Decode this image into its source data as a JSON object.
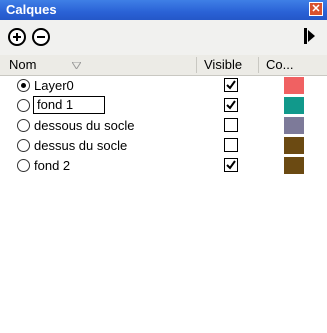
{
  "window": {
    "title": "Calques"
  },
  "toolbar": {
    "add_icon": "plus-circle-icon",
    "remove_icon": "minus-circle-icon",
    "details_icon": "arrow-right-icon"
  },
  "columns": {
    "name": "Nom",
    "visible": "Visible",
    "color": "Co..."
  },
  "layers": [
    {
      "name": "Layer0",
      "active": true,
      "visible": true,
      "color": "#f06162"
    },
    {
      "name": "fond 1",
      "active": false,
      "visible": true,
      "color": "#11998b",
      "editing": true
    },
    {
      "name": "dessous du socle",
      "active": false,
      "visible": false,
      "color": "#7d7a99"
    },
    {
      "name": "dessus du socle",
      "active": false,
      "visible": false,
      "color": "#6b4a12"
    },
    {
      "name": "fond 2",
      "active": false,
      "visible": true,
      "color": "#6b4a12"
    }
  ]
}
